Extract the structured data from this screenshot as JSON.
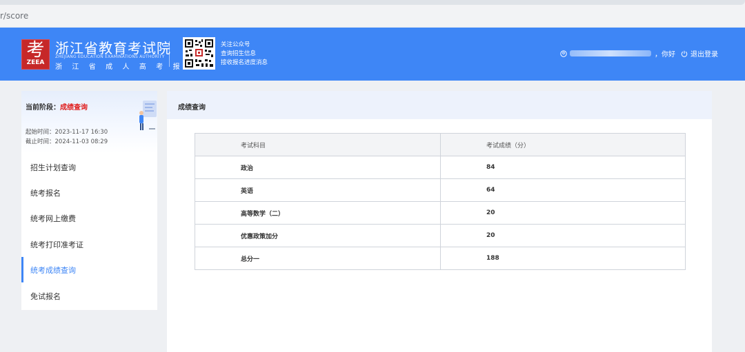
{
  "browser": {
    "url_fragment": "r/score"
  },
  "header": {
    "logo_char": "考",
    "logo_text": "ZEEA",
    "title": "浙江省教育考试院",
    "title_en": "ZHEJIANG EDUCATION EXAMINATIONS AUTHORITY",
    "subtitle": "浙 江 省 成 人 高 考 报 名",
    "qr_lines": [
      "关注公众号",
      "查询招生信息",
      "接收报名进度消息"
    ],
    "greeting": "，你好",
    "logout_label": "退出登录"
  },
  "sidebar": {
    "stage_label": "当前阶段：",
    "stage_value": "成绩查询",
    "start_time": "起始时间：2023-11-17 16:30",
    "end_time": "截止时间：2024-11-03 08:29",
    "items": [
      {
        "label": "招生计划查询",
        "active": false
      },
      {
        "label": "统考报名",
        "active": false
      },
      {
        "label": "统考网上缴费",
        "active": false
      },
      {
        "label": "统考打印准考证",
        "active": false
      },
      {
        "label": "统考成绩查询",
        "active": true
      },
      {
        "label": "免试报名",
        "active": false
      }
    ]
  },
  "main": {
    "title": "成绩查询",
    "table": {
      "headers": [
        "考试科目",
        "考试成绩（分）"
      ],
      "rows": [
        [
          "政治",
          "84"
        ],
        [
          "英语",
          "64"
        ],
        [
          "高等数学（二）",
          "20"
        ],
        [
          "优惠政策加分",
          "20"
        ],
        [
          "总分一",
          "188"
        ]
      ]
    }
  },
  "colors": {
    "primary": "#3e86f6",
    "stage_highlight": "#e02020",
    "logo_red": "#c62828"
  }
}
